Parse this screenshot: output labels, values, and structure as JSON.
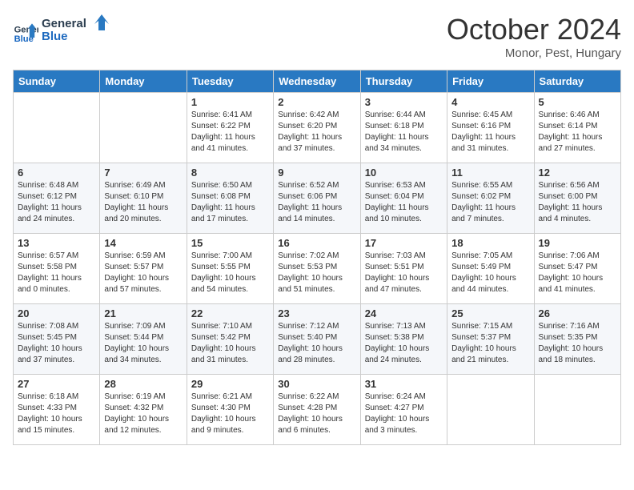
{
  "header": {
    "logo_line1": "General",
    "logo_line2": "Blue",
    "month": "October 2024",
    "location": "Monor, Pest, Hungary"
  },
  "days_of_week": [
    "Sunday",
    "Monday",
    "Tuesday",
    "Wednesday",
    "Thursday",
    "Friday",
    "Saturday"
  ],
  "weeks": [
    [
      {
        "day": "",
        "content": ""
      },
      {
        "day": "",
        "content": ""
      },
      {
        "day": "1",
        "content": "Sunrise: 6:41 AM\nSunset: 6:22 PM\nDaylight: 11 hours and 41 minutes."
      },
      {
        "day": "2",
        "content": "Sunrise: 6:42 AM\nSunset: 6:20 PM\nDaylight: 11 hours and 37 minutes."
      },
      {
        "day": "3",
        "content": "Sunrise: 6:44 AM\nSunset: 6:18 PM\nDaylight: 11 hours and 34 minutes."
      },
      {
        "day": "4",
        "content": "Sunrise: 6:45 AM\nSunset: 6:16 PM\nDaylight: 11 hours and 31 minutes."
      },
      {
        "day": "5",
        "content": "Sunrise: 6:46 AM\nSunset: 6:14 PM\nDaylight: 11 hours and 27 minutes."
      }
    ],
    [
      {
        "day": "6",
        "content": "Sunrise: 6:48 AM\nSunset: 6:12 PM\nDaylight: 11 hours and 24 minutes."
      },
      {
        "day": "7",
        "content": "Sunrise: 6:49 AM\nSunset: 6:10 PM\nDaylight: 11 hours and 20 minutes."
      },
      {
        "day": "8",
        "content": "Sunrise: 6:50 AM\nSunset: 6:08 PM\nDaylight: 11 hours and 17 minutes."
      },
      {
        "day": "9",
        "content": "Sunrise: 6:52 AM\nSunset: 6:06 PM\nDaylight: 11 hours and 14 minutes."
      },
      {
        "day": "10",
        "content": "Sunrise: 6:53 AM\nSunset: 6:04 PM\nDaylight: 11 hours and 10 minutes."
      },
      {
        "day": "11",
        "content": "Sunrise: 6:55 AM\nSunset: 6:02 PM\nDaylight: 11 hours and 7 minutes."
      },
      {
        "day": "12",
        "content": "Sunrise: 6:56 AM\nSunset: 6:00 PM\nDaylight: 11 hours and 4 minutes."
      }
    ],
    [
      {
        "day": "13",
        "content": "Sunrise: 6:57 AM\nSunset: 5:58 PM\nDaylight: 11 hours and 0 minutes."
      },
      {
        "day": "14",
        "content": "Sunrise: 6:59 AM\nSunset: 5:57 PM\nDaylight: 10 hours and 57 minutes."
      },
      {
        "day": "15",
        "content": "Sunrise: 7:00 AM\nSunset: 5:55 PM\nDaylight: 10 hours and 54 minutes."
      },
      {
        "day": "16",
        "content": "Sunrise: 7:02 AM\nSunset: 5:53 PM\nDaylight: 10 hours and 51 minutes."
      },
      {
        "day": "17",
        "content": "Sunrise: 7:03 AM\nSunset: 5:51 PM\nDaylight: 10 hours and 47 minutes."
      },
      {
        "day": "18",
        "content": "Sunrise: 7:05 AM\nSunset: 5:49 PM\nDaylight: 10 hours and 44 minutes."
      },
      {
        "day": "19",
        "content": "Sunrise: 7:06 AM\nSunset: 5:47 PM\nDaylight: 10 hours and 41 minutes."
      }
    ],
    [
      {
        "day": "20",
        "content": "Sunrise: 7:08 AM\nSunset: 5:45 PM\nDaylight: 10 hours and 37 minutes."
      },
      {
        "day": "21",
        "content": "Sunrise: 7:09 AM\nSunset: 5:44 PM\nDaylight: 10 hours and 34 minutes."
      },
      {
        "day": "22",
        "content": "Sunrise: 7:10 AM\nSunset: 5:42 PM\nDaylight: 10 hours and 31 minutes."
      },
      {
        "day": "23",
        "content": "Sunrise: 7:12 AM\nSunset: 5:40 PM\nDaylight: 10 hours and 28 minutes."
      },
      {
        "day": "24",
        "content": "Sunrise: 7:13 AM\nSunset: 5:38 PM\nDaylight: 10 hours and 24 minutes."
      },
      {
        "day": "25",
        "content": "Sunrise: 7:15 AM\nSunset: 5:37 PM\nDaylight: 10 hours and 21 minutes."
      },
      {
        "day": "26",
        "content": "Sunrise: 7:16 AM\nSunset: 5:35 PM\nDaylight: 10 hours and 18 minutes."
      }
    ],
    [
      {
        "day": "27",
        "content": "Sunrise: 6:18 AM\nSunset: 4:33 PM\nDaylight: 10 hours and 15 minutes."
      },
      {
        "day": "28",
        "content": "Sunrise: 6:19 AM\nSunset: 4:32 PM\nDaylight: 10 hours and 12 minutes."
      },
      {
        "day": "29",
        "content": "Sunrise: 6:21 AM\nSunset: 4:30 PM\nDaylight: 10 hours and 9 minutes."
      },
      {
        "day": "30",
        "content": "Sunrise: 6:22 AM\nSunset: 4:28 PM\nDaylight: 10 hours and 6 minutes."
      },
      {
        "day": "31",
        "content": "Sunrise: 6:24 AM\nSunset: 4:27 PM\nDaylight: 10 hours and 3 minutes."
      },
      {
        "day": "",
        "content": ""
      },
      {
        "day": "",
        "content": ""
      }
    ]
  ]
}
